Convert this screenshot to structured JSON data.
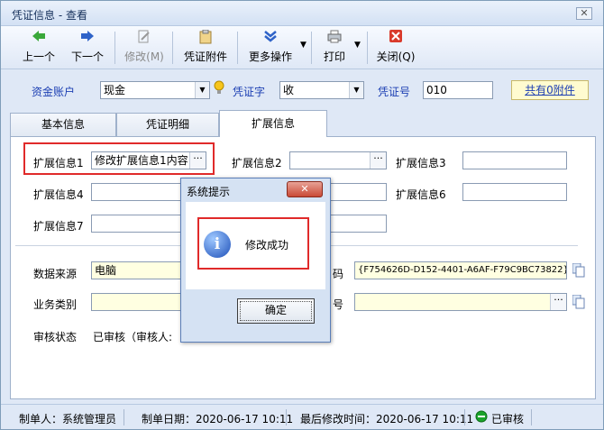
{
  "window": {
    "title": "凭证信息 - 查看",
    "close_glyph": "✕"
  },
  "toolbar": {
    "prev": "上一个",
    "next": "下一个",
    "modify": "修改(M)",
    "attach": "凭证附件",
    "more": "更多操作",
    "print": "打印",
    "close": "关闭(Q)"
  },
  "header": {
    "account_label": "资金账户",
    "account_value": "现金",
    "voucher_char_label": "凭证字",
    "voucher_char_value": "收",
    "voucher_no_label": "凭证号",
    "voucher_no_value": "010",
    "attachments_link": "共有0附件"
  },
  "tabs": [
    "基本信息",
    "凭证明细",
    "扩展信息"
  ],
  "ext": {
    "f1_label": "扩展信息1",
    "f1_value": "修改扩展信息1内容",
    "f2_label": "扩展信息2",
    "f3_label": "扩展信息3",
    "f4_label": "扩展信息4",
    "f6_label": "扩展信息6",
    "f7_label": "扩展信息7"
  },
  "info": {
    "source_label": "数据来源",
    "source_value": "电脑",
    "code_label_partial": "码",
    "code_value": "{F754626D-D152-4401-A6AF-F79C9BC73822}",
    "biz_label": "业务类别",
    "no_label_partial": "号",
    "audit_label": "审核状态",
    "audit_value": "已审核（审核人:"
  },
  "status": {
    "maker": "制单人：系统管理员",
    "make_date": "制单日期：2020-06-17 10:11",
    "last_modified": "最后修改时间：2020-06-17 10:11",
    "audit": "已审核"
  },
  "dialog": {
    "title": "系统提示",
    "message": "修改成功",
    "ok": "确定",
    "close_glyph": "✕"
  },
  "colors": {
    "accent_red": "#e02a2a",
    "label_blue": "#1c3fb3",
    "status_green": "#1aa32a"
  }
}
